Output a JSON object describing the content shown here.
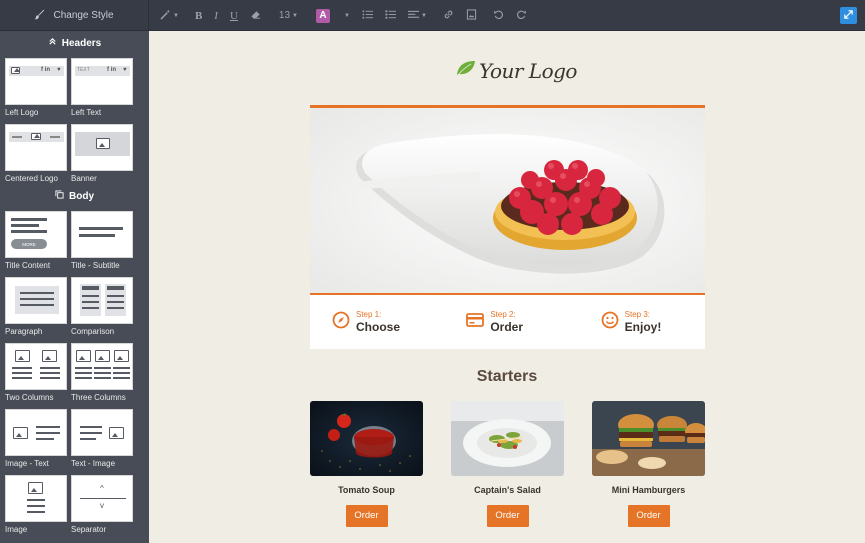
{
  "toolbar": {
    "change_style_label": "Change Style",
    "font_size": "13",
    "bold_label": "B",
    "italic_label": "I",
    "underline_label": "U",
    "text_color_label": "A",
    "icons": [
      "paint-brush-icon",
      "magic-wand-icon",
      "eraser-icon",
      "bullet-list-icon",
      "numbered-list-icon",
      "align-icon",
      "link-icon",
      "image-icon",
      "undo-icon",
      "redo-icon",
      "expand-icon"
    ],
    "accent_color": "#b05aa8",
    "expand_color": "#2e8fe0"
  },
  "sidebar": {
    "headers_title": "Headers",
    "headers_blocks": [
      {
        "label": "Left Logo",
        "thumb_text": "f in"
      },
      {
        "label": "Left Text",
        "thumb_text": "TEXT",
        "thumb_text2": "f in"
      },
      {
        "label": "Centered Logo"
      },
      {
        "label": "Banner"
      }
    ],
    "body_title": "Body",
    "body_blocks": [
      {
        "label": "Title Content",
        "thumb_text": "MORE"
      },
      {
        "label": "Title - Subtitle"
      },
      {
        "label": "Paragraph"
      },
      {
        "label": "Comparison"
      },
      {
        "label": "Two Columns"
      },
      {
        "label": "Three Columns"
      },
      {
        "label": "Image - Text"
      },
      {
        "label": "Text - Image"
      },
      {
        "label": "Image"
      },
      {
        "label": "Separator",
        "thumb_text": "^",
        "thumb_text2": "v"
      }
    ]
  },
  "email": {
    "logo_text": "Your Logo",
    "brand_color": "#e67426",
    "steps": [
      {
        "small": "Step 1:",
        "big": "Choose",
        "icon": "compass-icon"
      },
      {
        "small": "Step 2:",
        "big": "Order",
        "icon": "credit-card-icon"
      },
      {
        "small": "Step 3:",
        "big": "Enjoy!",
        "icon": "smiley-icon"
      }
    ],
    "section_title": "Starters",
    "products": [
      {
        "name": "Tomato Soup",
        "button": "Order"
      },
      {
        "name": "Captain's Salad",
        "button": "Order"
      },
      {
        "name": "Mini Hamburgers",
        "button": "Order"
      }
    ]
  }
}
